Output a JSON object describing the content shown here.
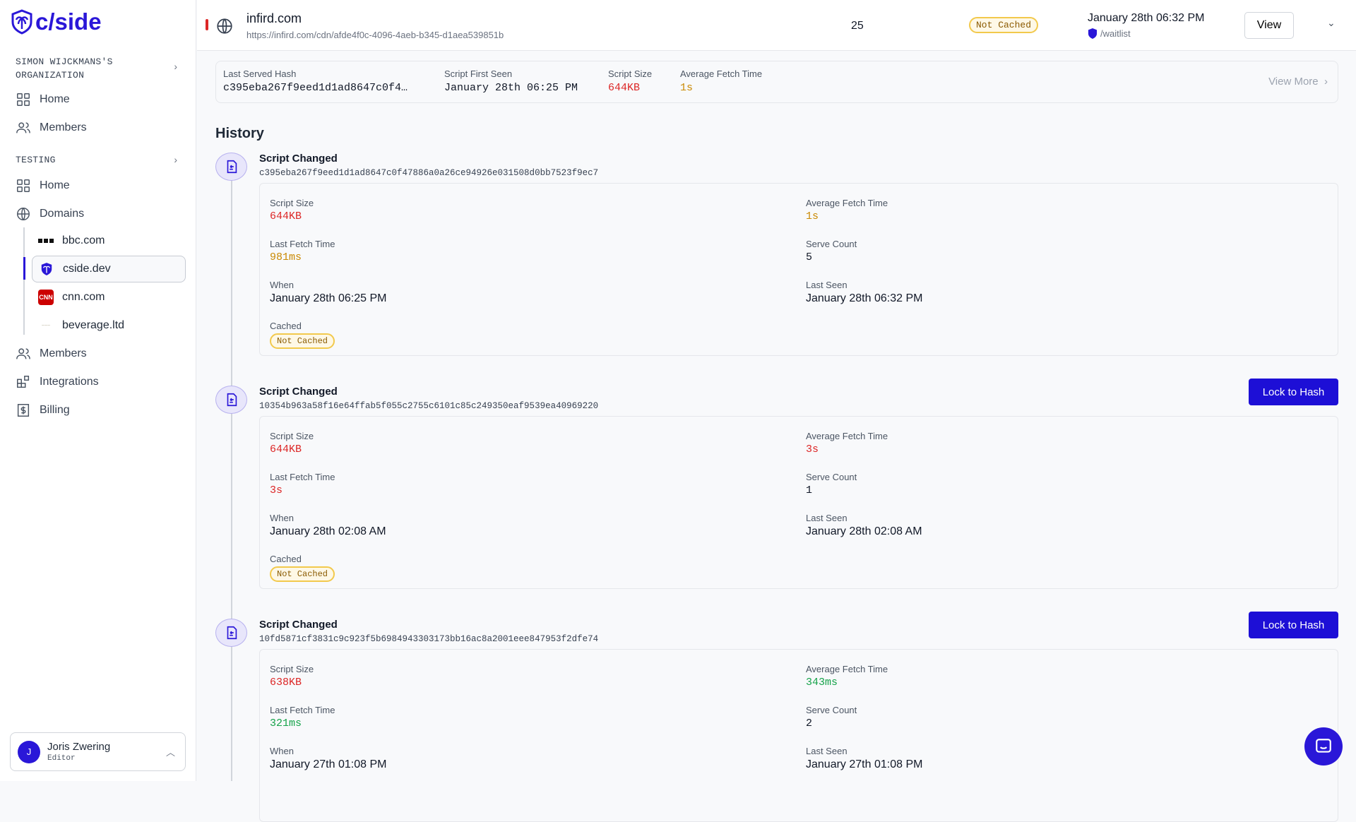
{
  "sidebar": {
    "logo": "c/side",
    "org": "SIMON WIJCKMANS'S ORGANIZATION",
    "org_items": [
      {
        "label": "Home",
        "icon": "grid-icon"
      },
      {
        "label": "Members",
        "icon": "users-icon"
      }
    ],
    "section": "TESTING",
    "items": [
      {
        "label": "Home",
        "icon": "grid-icon"
      },
      {
        "label": "Domains",
        "icon": "globe-icon"
      }
    ],
    "domains": [
      {
        "label": "bbc.com"
      },
      {
        "label": "cside.dev",
        "active": true
      },
      {
        "label": "cnn.com"
      },
      {
        "label": "beverage.ltd"
      }
    ],
    "bottom_items": [
      {
        "label": "Members",
        "icon": "users-icon"
      },
      {
        "label": "Integrations",
        "icon": "integrations-icon"
      },
      {
        "label": "Billing",
        "icon": "billing-icon"
      }
    ],
    "user": {
      "initial": "J",
      "name": "Joris Zwering",
      "role": "Editor"
    }
  },
  "header": {
    "domain": "infird.com",
    "url": "https://infird.com/cdn/afde4f0c-4096-4aeb-b345-d1aea539851b",
    "count": "25",
    "cache_status": "Not Cached",
    "last_seen": "January 28th 06:32 PM",
    "page": "/waitlist",
    "view_label": "View"
  },
  "summary": {
    "hash_label": "Last Served Hash",
    "hash": "c395eba267f9eed1d1ad8647c0f4…",
    "first_seen_label": "Script First Seen",
    "first_seen": "January 28th 06:25 PM",
    "size_label": "Script Size",
    "size": "644KB",
    "fetch_label": "Average Fetch Time",
    "fetch": "1s",
    "view_more": "View More"
  },
  "history": {
    "title": "History",
    "lock_label": "Lock to Hash",
    "labels": {
      "size": "Script Size",
      "avg": "Average Fetch Time",
      "last": "Last Fetch Time",
      "count": "Serve Count",
      "when": "When",
      "seen": "Last Seen",
      "cached": "Cached"
    },
    "items": [
      {
        "title": "Script Changed",
        "hash": "c395eba267f9eed1d1ad8647c0f47886a0a26ce94926e031508d0bb7523f9ec7",
        "lock": false,
        "size": "644KB",
        "size_color": "red",
        "avg": "1s",
        "avg_color": "amber",
        "last": "981ms",
        "last_color": "amber",
        "count": "5",
        "when": "January 28th 06:25 PM",
        "seen": "January 28th 06:32 PM",
        "cached": "Not Cached"
      },
      {
        "title": "Script Changed",
        "hash": "10354b963a58f16e64ffab5f055c2755c6101c85c249350eaf9539ea40969220",
        "lock": true,
        "size": "644KB",
        "size_color": "red",
        "avg": "3s",
        "avg_color": "red",
        "last": "3s",
        "last_color": "red",
        "count": "1",
        "when": "January 28th 02:08 AM",
        "seen": "January 28th 02:08 AM",
        "cached": "Not Cached"
      },
      {
        "title": "Script Changed",
        "hash": "10fd5871cf3831c9c923f5b6984943303173bb16ac8a2001eee847953f2dfe74",
        "lock": true,
        "size": "638KB",
        "size_color": "red",
        "avg": "343ms",
        "avg_color": "green",
        "last": "321ms",
        "last_color": "green",
        "count": "2",
        "when": "January 27th 01:08 PM",
        "seen": "January 27th 01:08 PM"
      }
    ]
  },
  "colors": {
    "brand": "#2a17d8",
    "button": "#1d0fd6",
    "red": "#dc2626",
    "amber": "#ca8a04",
    "green": "#16a34a"
  }
}
